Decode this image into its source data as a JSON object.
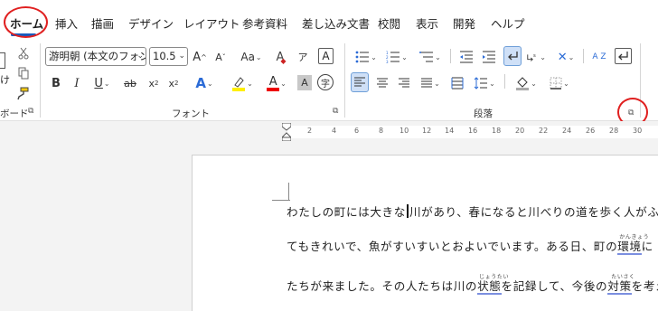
{
  "tabs": [
    {
      "label": "ホーム",
      "active": true
    },
    {
      "label": "挿入"
    },
    {
      "label": "描画"
    },
    {
      "label": "デザイン"
    },
    {
      "label": "レイアウト"
    },
    {
      "label": "参考資料"
    },
    {
      "label": "差し込み文書"
    },
    {
      "label": "校閲"
    },
    {
      "label": "表示"
    },
    {
      "label": "開発"
    },
    {
      "label": "ヘルプ"
    }
  ],
  "clipboard": {
    "paste_partial": "け",
    "group_label_partial": "ボード"
  },
  "font": {
    "font_name": "游明朝 (本文のフォン",
    "font_size": "10.5",
    "grow_label": "A",
    "shrink_label": "A",
    "change_case_label": "Aa",
    "clear_format_label": "A",
    "phonetic_label": "ア",
    "char_border_label": "A",
    "bold_label": "B",
    "italic_label": "I",
    "underline_label": "U",
    "strike_label": "ab",
    "subscript_label": "x",
    "superscript_label": "x",
    "effects_label": "A",
    "highlight_label": "ab",
    "font_color_label": "A",
    "shading_label": "A",
    "enclose_label": "字",
    "group_label": "フォント"
  },
  "paragraph": {
    "sort_label": "A Z",
    "group_label": "段落"
  },
  "accent_color": "#185abd",
  "ruler": {
    "numbers": [
      "2",
      "4",
      "6",
      "8",
      "10",
      "12",
      "14",
      "16",
      "18",
      "20",
      "22",
      "24",
      "26",
      "28",
      "30"
    ]
  },
  "document": {
    "line1_a": "わたしの町には大きな",
    "line1_b": "川があり、春になると川べりの道を歩く人がふえ",
    "line2_a": "てもきれいで、魚がすいすいとおよいでいます。ある日、町の",
    "line2_u": "環境",
    "line2_b": "に",
    "line2_ruby": "かんきょう",
    "line3_a": "たちが来ました。その人たちは川の",
    "line3_u1": "状態",
    "line3_b": "を記録して、今後の",
    "line3_u2": "対策",
    "line3_c": "を考え",
    "line3_ruby1": "じょうたい",
    "line3_ruby2": "たいさく"
  }
}
